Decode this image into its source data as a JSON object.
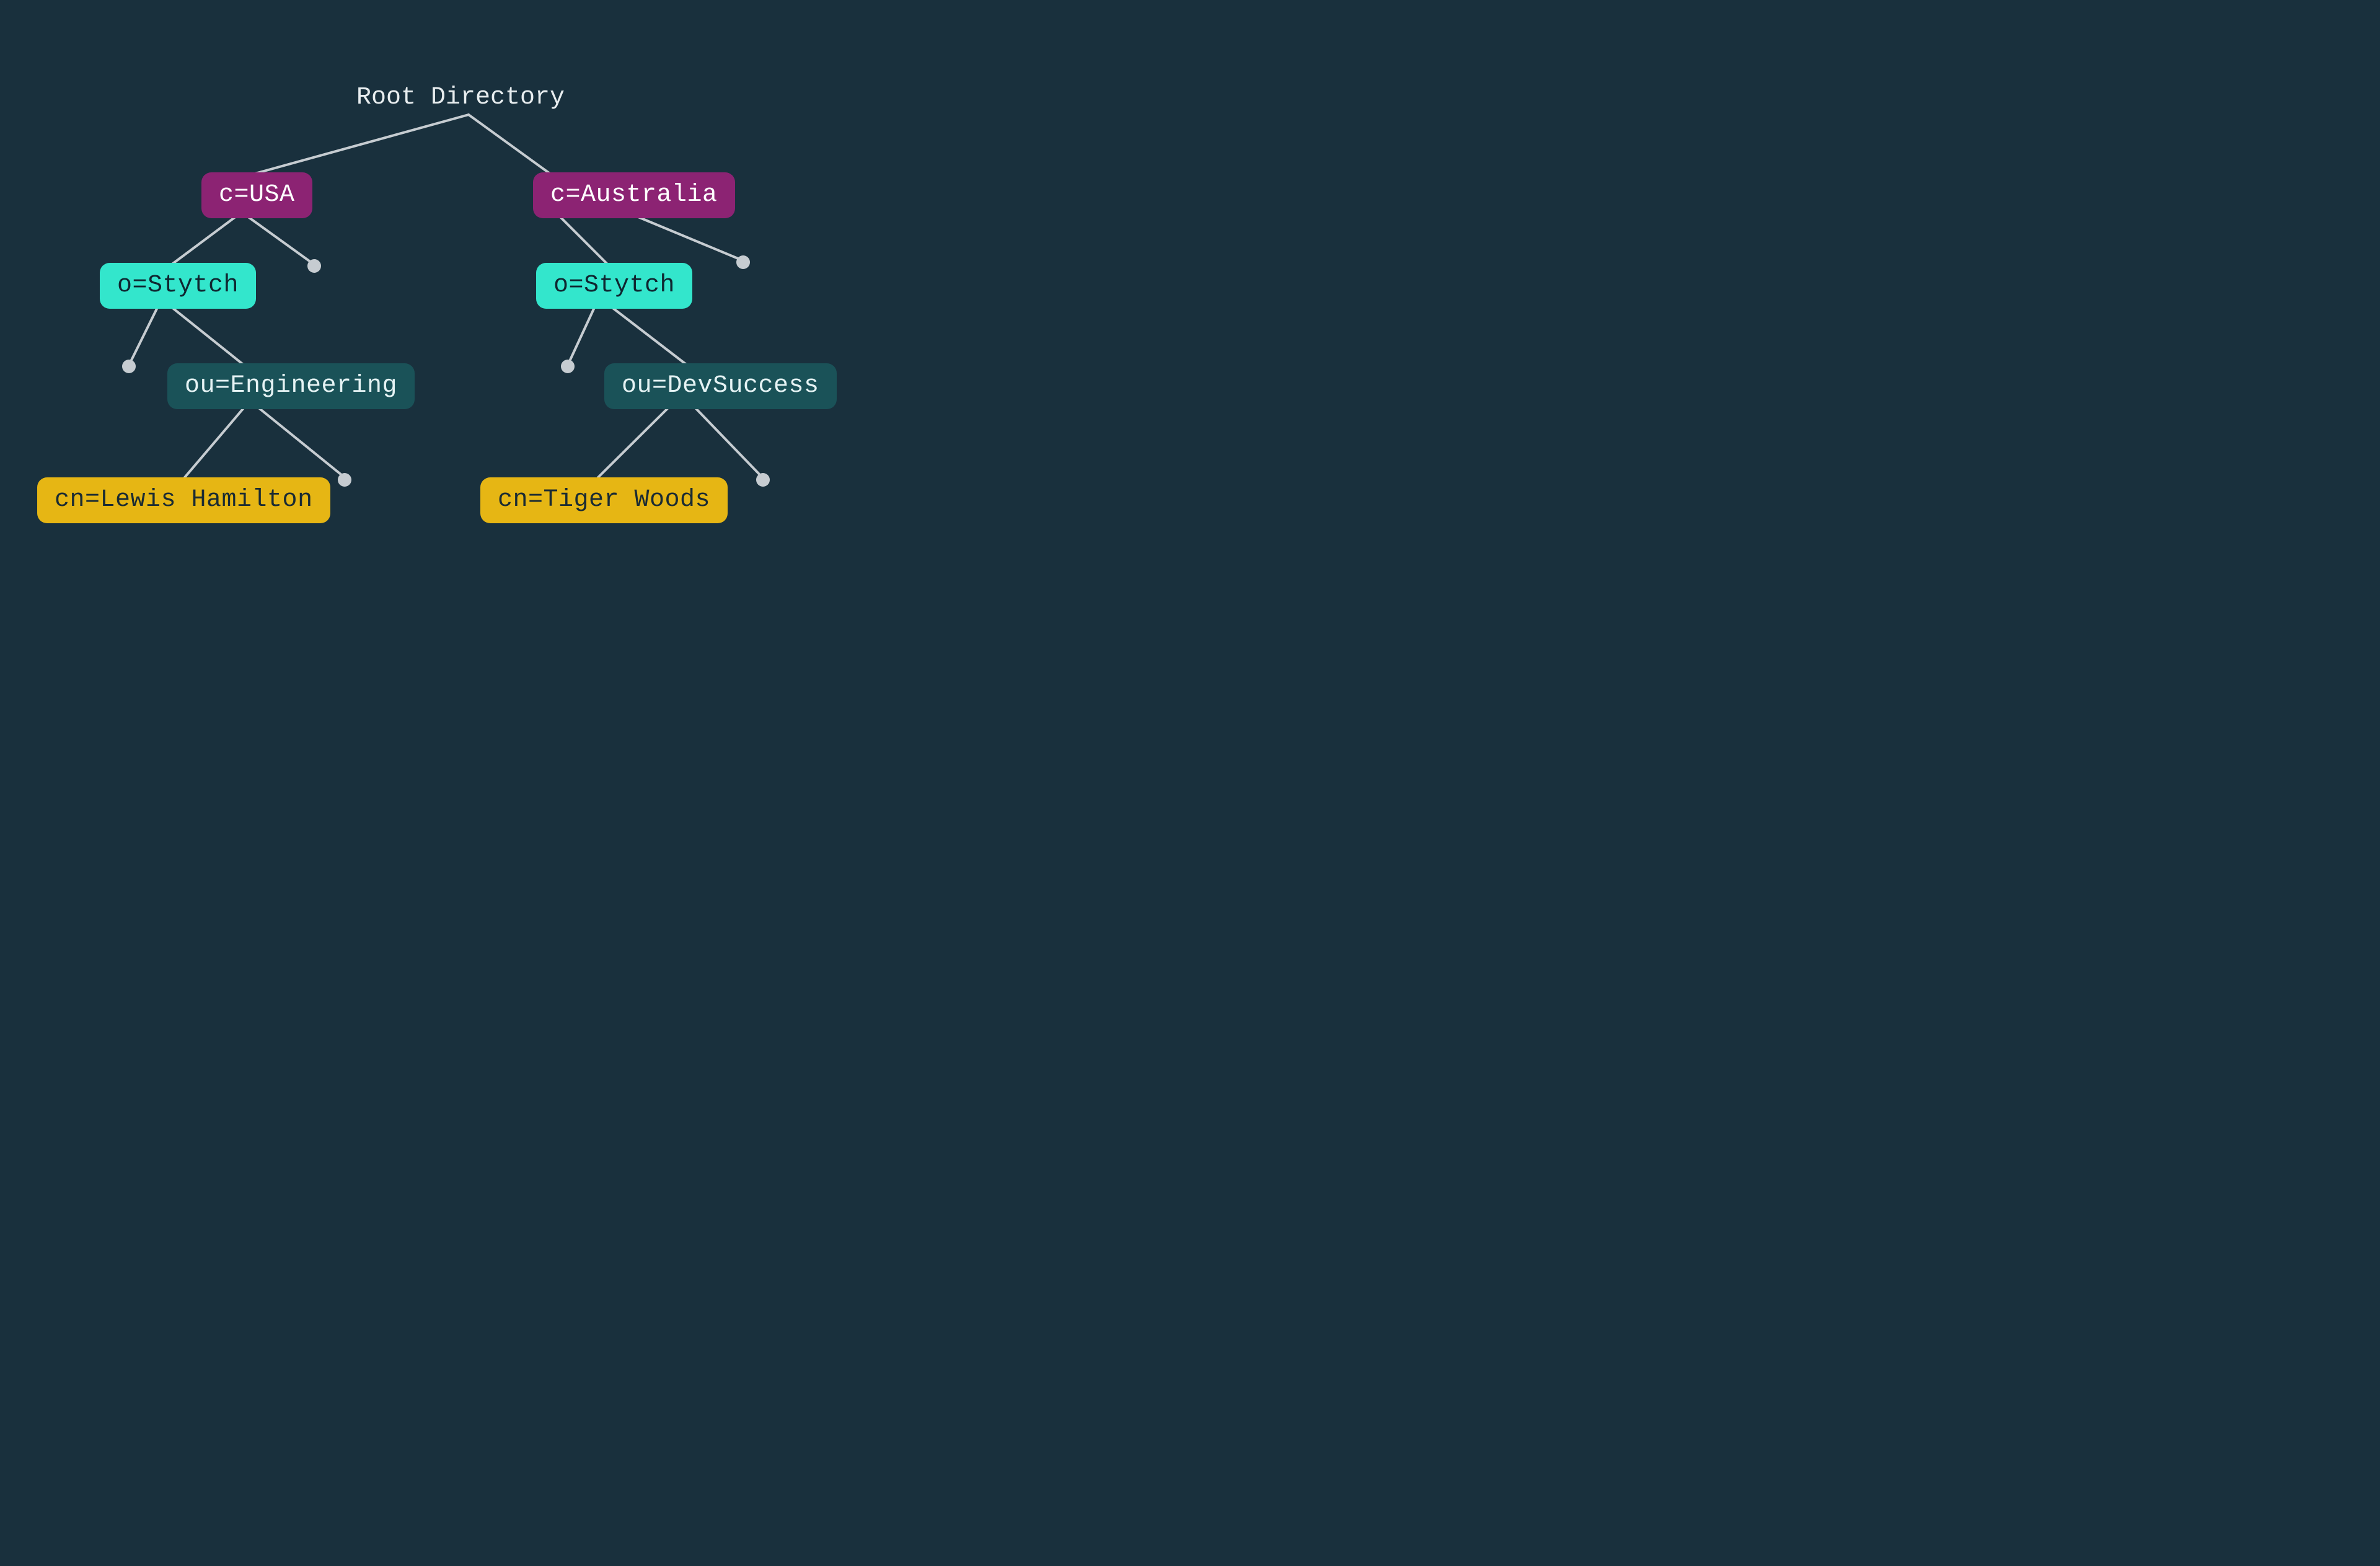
{
  "colors": {
    "background": "#19303d",
    "line": "#c6ccd1",
    "dot": "#c6ccd1",
    "root_text": "#e8edef",
    "country_bg": "#8c2373",
    "country_fg": "#ffffff",
    "org_bg": "#33e6cc",
    "org_fg": "#0f2630",
    "ou_bg": "#1a5258",
    "ou_fg": "#e5f3f4",
    "cn_bg": "#e6b614",
    "cn_fg": "#1a2b33"
  },
  "root": {
    "label": "Root Directory"
  },
  "left": {
    "country": "c=USA",
    "org": "o=Stytch",
    "ou": "ou=Engineering",
    "cn": "cn=Lewis Hamilton"
  },
  "right": {
    "country": "c=Australia",
    "org": "o=Stytch",
    "ou": "ou=DevSuccess",
    "cn": "cn=Tiger Woods"
  }
}
